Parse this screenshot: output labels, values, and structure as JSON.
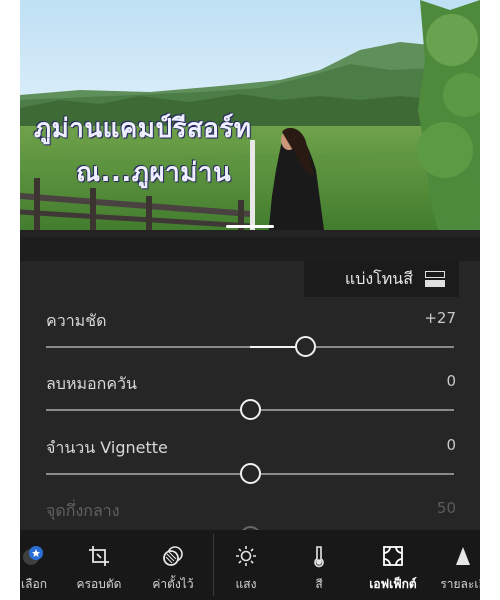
{
  "photo": {
    "overlay_line1": "ภูม่านแคมป์รีสอร์ท",
    "overlay_line2": "ณ...ภูผาม่าน"
  },
  "panel": {
    "tone_button_label": "แบ่งโทนสี",
    "tone_button_icon": "split-tone-icon",
    "sliders": [
      {
        "label": "ความชัด",
        "value": "+27",
        "level": 0.635
      },
      {
        "label": "ลบหมอกควัน",
        "value": "0",
        "level": 0.5
      },
      {
        "label": "จำนวน Vignette",
        "value": "0",
        "level": 0.5
      },
      {
        "label": "จุดกึ่งกลาง",
        "value": "50",
        "level": 0.5
      }
    ]
  },
  "toolbar": {
    "tools": [
      {
        "label": "เลือก",
        "icon": "select-icon"
      },
      {
        "label": "ครอบตัด",
        "icon": "crop-icon"
      },
      {
        "label": "ค่าตั้งไว้",
        "icon": "presets-icon"
      },
      {
        "label": "แสง",
        "icon": "light-icon"
      },
      {
        "label": "สี",
        "icon": "color-icon"
      },
      {
        "label": "เอฟเฟ็กต์",
        "icon": "effects-icon",
        "active": true
      },
      {
        "label": "รายละเอี",
        "icon": "detail-icon"
      }
    ]
  },
  "colors": {
    "panel_bg": "#262626",
    "toolbar_bg": "#181818",
    "accent_badge": "#2b6fd6",
    "active_text": "#ffffff"
  }
}
